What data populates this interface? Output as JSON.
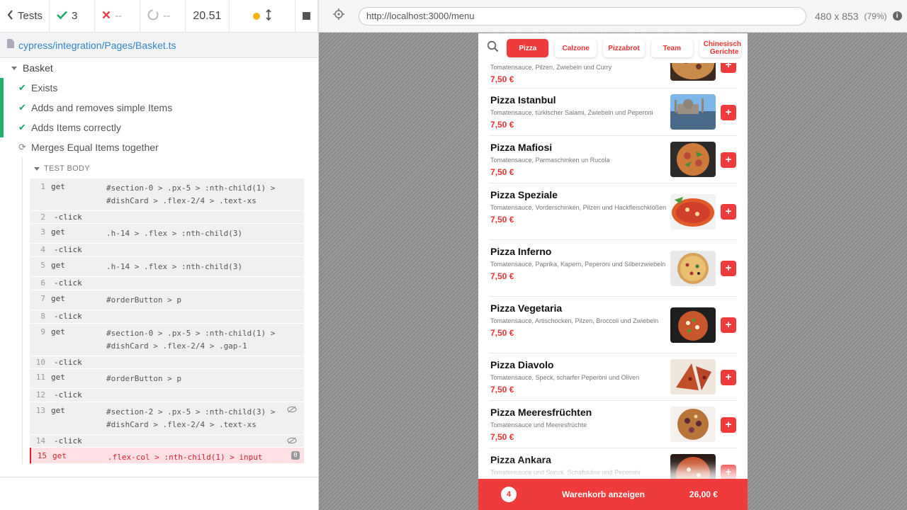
{
  "runner": {
    "tests_label": "Tests",
    "passed": "3",
    "failed": "--",
    "pending": "--",
    "duration": "20.51",
    "file_path": "cypress/integration/Pages/Basket.ts",
    "suite": "Basket",
    "tests": [
      {
        "label": "Exists",
        "state": "passed"
      },
      {
        "label": "Adds and removes simple Items",
        "state": "passed"
      },
      {
        "label": "Adds Items correctly",
        "state": "passed"
      },
      {
        "label": "Merges Equal Items together",
        "state": "running"
      }
    ],
    "test_body_label": "TEST BODY",
    "commands": [
      {
        "n": "1",
        "name": "get",
        "msg": "#section-0 > .px-5 > :nth-child(1) > #dishCard > .flex-2/4 > .text-xs"
      },
      {
        "n": "2",
        "name": "-click",
        "msg": ""
      },
      {
        "n": "3",
        "name": "get",
        "msg": ".h-14 > .flex > :nth-child(3)"
      },
      {
        "n": "4",
        "name": "-click",
        "msg": ""
      },
      {
        "n": "5",
        "name": "get",
        "msg": ".h-14 > .flex > :nth-child(3)"
      },
      {
        "n": "6",
        "name": "-click",
        "msg": ""
      },
      {
        "n": "7",
        "name": "get",
        "msg": "#orderButton > p"
      },
      {
        "n": "8",
        "name": "-click",
        "msg": ""
      },
      {
        "n": "9",
        "name": "get",
        "msg": "#section-0 > .px-5 > :nth-child(1) > #dishCard > .flex-2/4 > .gap-1"
      },
      {
        "n": "10",
        "name": "-click",
        "msg": ""
      },
      {
        "n": "11",
        "name": "get",
        "msg": "#orderButton > p"
      },
      {
        "n": "12",
        "name": "-click",
        "msg": ""
      },
      {
        "n": "13",
        "name": "get",
        "msg": "#section-2 > .px-5 > :nth-child(3) > #dishCard > .flex-2/4 > .text-xs"
      },
      {
        "n": "14",
        "name": "-click",
        "msg": ""
      },
      {
        "n": "15",
        "name": "get",
        "msg": ".flex-col > :nth-child(1) > input",
        "badge": "0"
      }
    ]
  },
  "aut": {
    "url": "http://localhost:3000/menu",
    "viewport": "480 x 853",
    "zoom": "(79%)",
    "categories": [
      "Pizza",
      "Calzone",
      "Pizzabrot",
      "Team",
      "Chinesische Gerichte"
    ],
    "active_category": "Pizza",
    "dishes": [
      {
        "title": "",
        "desc": "Tomatensauce, Pilzen, Zwiebeln und Curry",
        "price": "7,50 €"
      },
      {
        "title": "Pizza Istanbul",
        "desc": "Tomatensauce, türkischer Salami, Zwiebeln und Peperoni",
        "price": "7,50 €"
      },
      {
        "title": "Pizza Mafiosi",
        "desc": "Tomatensauce, Parmaschinken un Rucola",
        "price": "7,50 €"
      },
      {
        "title": "Pizza Speziale",
        "desc": "Tomatensauce, Vorderschinken, Pilzen und Hackfleischklößen",
        "price": "7,50 €"
      },
      {
        "title": "Pizza Inferno",
        "desc": "Tomatensauce, Paprika, Kapern, Peperoni und Silberzwiebeln",
        "price": "7,50 €"
      },
      {
        "title": "Pizza Vegetaria",
        "desc": "Tomatensauce, Artischocken, Pilzen, Broccoli und Zwiebeln",
        "price": "7,50 €"
      },
      {
        "title": "Pizza Diavolo",
        "desc": "Tomatensauce, Speck, scharfer Peperoni und Oliven",
        "price": "7,50 €"
      },
      {
        "title": "Pizza Meeresfrüchten",
        "desc": "Tomatensauce und Meeresfrüchte",
        "price": "7,50 €"
      },
      {
        "title": "Pizza Ankara",
        "desc": "Tomatensauce und Sucuk, Schafskäse und Peperoni",
        "price": ""
      }
    ],
    "cart": {
      "count": "4",
      "label": "Warenkorb anzeigen",
      "total": "26,00 €"
    }
  }
}
